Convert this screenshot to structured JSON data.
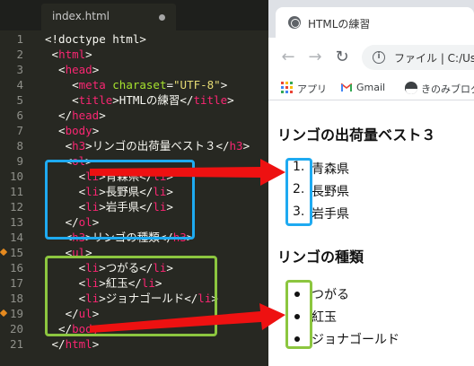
{
  "editor": {
    "tab_title": "index.html",
    "line_numbers": [
      "1",
      "2",
      "3",
      "4",
      "5",
      "6",
      "7",
      "8",
      "9",
      "10",
      "11",
      "12",
      "13",
      "14",
      "15",
      "16",
      "17",
      "18",
      "19",
      "20",
      "21"
    ],
    "lines": [
      [
        {
          "t": "<!doctype html>",
          "c": "tx"
        }
      ],
      [
        {
          "t": " "
        },
        {
          "t": "<",
          "c": "tx"
        },
        {
          "t": "html",
          "c": "tg"
        },
        {
          "t": ">",
          "c": "tx"
        }
      ],
      [
        {
          "t": "  <",
          "c": "tx"
        },
        {
          "t": "head",
          "c": "tg"
        },
        {
          "t": ">",
          "c": "tx"
        }
      ],
      [
        {
          "t": "    <",
          "c": "tx"
        },
        {
          "t": "meta",
          "c": "tg"
        },
        {
          "t": " charaset",
          "c": "at"
        },
        {
          "t": "=",
          "c": "tx"
        },
        {
          "t": "\"UTF-8\"",
          "c": "st"
        },
        {
          "t": ">",
          "c": "tx"
        }
      ],
      [
        {
          "t": "    <",
          "c": "tx"
        },
        {
          "t": "title",
          "c": "tg"
        },
        {
          "t": ">HTMLの練習</",
          "c": "tx"
        },
        {
          "t": "title",
          "c": "tg"
        },
        {
          "t": ">",
          "c": "tx"
        }
      ],
      [
        {
          "t": "  </",
          "c": "tx"
        },
        {
          "t": "head",
          "c": "tg"
        },
        {
          "t": ">",
          "c": "tx"
        }
      ],
      [
        {
          "t": "  <",
          "c": "tx"
        },
        {
          "t": "body",
          "c": "tg"
        },
        {
          "t": ">",
          "c": "tx"
        }
      ],
      [
        {
          "t": "   <",
          "c": "tx"
        },
        {
          "t": "h3",
          "c": "tg"
        },
        {
          "t": ">リンゴの出荷量ベスト３</",
          "c": "tx"
        },
        {
          "t": "h3",
          "c": "tg"
        },
        {
          "t": ">",
          "c": "tx"
        }
      ],
      [
        {
          "t": "   <",
          "c": "tx"
        },
        {
          "t": "ol",
          "c": "tg"
        },
        {
          "t": ">",
          "c": "tx"
        }
      ],
      [
        {
          "t": "     <",
          "c": "tx"
        },
        {
          "t": "li",
          "c": "tg"
        },
        {
          "t": ">青森県</",
          "c": "tx"
        },
        {
          "t": "li",
          "c": "tg"
        },
        {
          "t": ">",
          "c": "tx"
        }
      ],
      [
        {
          "t": "     <",
          "c": "tx"
        },
        {
          "t": "li",
          "c": "tg"
        },
        {
          "t": ">長野県</",
          "c": "tx"
        },
        {
          "t": "li",
          "c": "tg"
        },
        {
          "t": ">",
          "c": "tx"
        }
      ],
      [
        {
          "t": "     <",
          "c": "tx"
        },
        {
          "t": "li",
          "c": "tg"
        },
        {
          "t": ">岩手県</",
          "c": "tx"
        },
        {
          "t": "li",
          "c": "tg"
        },
        {
          "t": ">",
          "c": "tx"
        }
      ],
      [
        {
          "t": "   </",
          "c": "tx"
        },
        {
          "t": "ol",
          "c": "tg"
        },
        {
          "t": ">",
          "c": "tx"
        }
      ],
      [
        {
          "t": "   <",
          "c": "tx"
        },
        {
          "t": "h3",
          "c": "tg"
        },
        {
          "t": ">リンゴの種類</",
          "c": "tx"
        },
        {
          "t": "h3",
          "c": "tg"
        },
        {
          "t": ">",
          "c": "tx"
        }
      ],
      [
        {
          "t": "   <",
          "c": "tx"
        },
        {
          "t": "ul",
          "c": "tg"
        },
        {
          "t": ">",
          "c": "tx"
        }
      ],
      [
        {
          "t": "     <",
          "c": "tx"
        },
        {
          "t": "li",
          "c": "tg"
        },
        {
          "t": ">つがる</",
          "c": "tx"
        },
        {
          "t": "li",
          "c": "tg"
        },
        {
          "t": ">",
          "c": "tx"
        }
      ],
      [
        {
          "t": "     <",
          "c": "tx"
        },
        {
          "t": "li",
          "c": "tg"
        },
        {
          "t": ">紅玉</",
          "c": "tx"
        },
        {
          "t": "li",
          "c": "tg"
        },
        {
          "t": ">",
          "c": "tx"
        }
      ],
      [
        {
          "t": "     <",
          "c": "tx"
        },
        {
          "t": "li",
          "c": "tg"
        },
        {
          "t": ">ジョナゴールド</",
          "c": "tx"
        },
        {
          "t": "li",
          "c": "tg"
        },
        {
          "t": ">",
          "c": "tx"
        }
      ],
      [
        {
          "t": "   </",
          "c": "tx"
        },
        {
          "t": "ul",
          "c": "tg"
        },
        {
          "t": ">",
          "c": "tx"
        }
      ],
      [
        {
          "t": "  </",
          "c": "tx"
        },
        {
          "t": "body",
          "c": "tg"
        },
        {
          "t": ">",
          "c": "tx"
        }
      ],
      [
        {
          "t": " </",
          "c": "tx"
        },
        {
          "t": "html",
          "c": "tg"
        },
        {
          "t": ">",
          "c": "tx"
        }
      ]
    ],
    "modified_line_numbers": [
      "15",
      "19"
    ]
  },
  "browser": {
    "tab_title": "HTMLの練習",
    "address": "ファイル | C:/Us",
    "bookmarks": [
      "アプリ",
      "Gmail",
      "きのみブログ"
    ],
    "page": {
      "heading_ol": "リンゴの出荷量ベスト３",
      "ol_items": [
        "青森県",
        "長野県",
        "岩手県"
      ],
      "ol_numbers": [
        "1.",
        "2.",
        "3."
      ],
      "heading_ul": "リンゴの種類",
      "ul_items": [
        "つがる",
        "紅玉",
        "ジョナゴールド"
      ]
    }
  },
  "annotations": {
    "ol_box_color": "#1eaaf1",
    "ul_box_color": "#8cc63f",
    "arrow_color": "#ee1111"
  },
  "colors": {
    "editor_bg": "#272822",
    "tag": "#f92672",
    "attribute": "#a6e22e",
    "string": "#e6db74",
    "text": "#f8f8f2",
    "line_number": "#8f908a"
  }
}
